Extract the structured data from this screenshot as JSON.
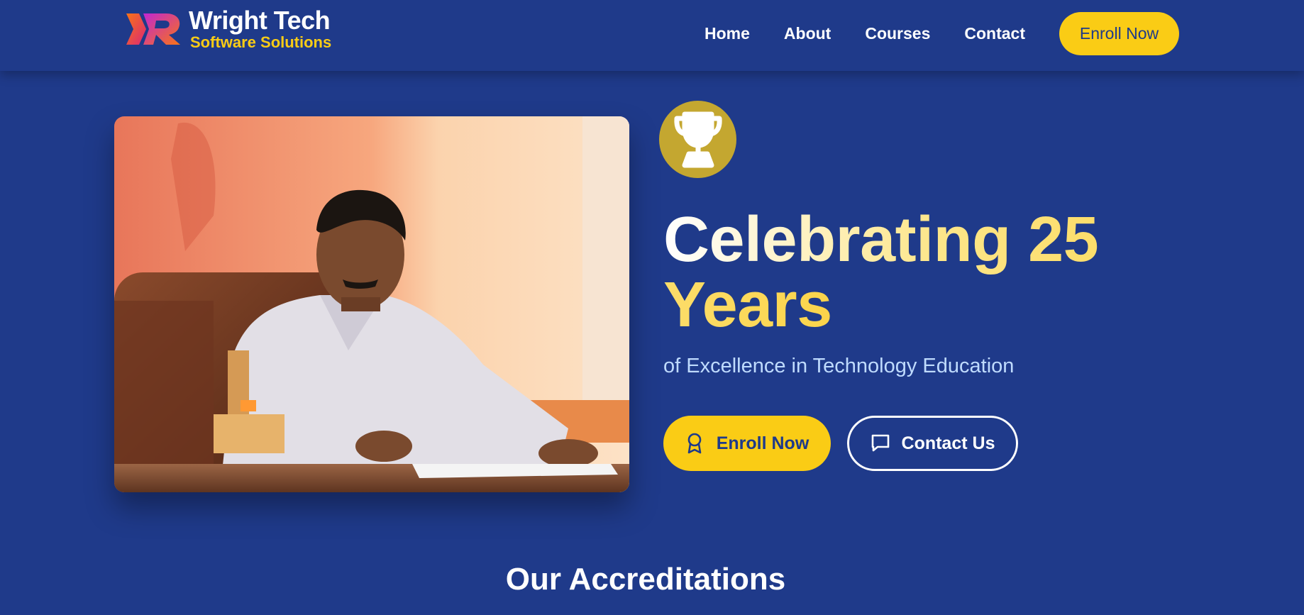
{
  "brand": {
    "name": "Wright Tech",
    "tagline": "Software Solutions",
    "logo_icon": "wr-logo-mark"
  },
  "nav": {
    "items": [
      {
        "label": "Home"
      },
      {
        "label": "About"
      },
      {
        "label": "Courses"
      },
      {
        "label": "Contact"
      }
    ],
    "enroll_label": "Enroll Now"
  },
  "hero": {
    "photo_alt": "Founder seated at office desk",
    "badge_icon": "trophy-icon",
    "headline": "Celebrating 25 Years",
    "subheadline": "of Excellence in Technology Education",
    "primary_button": {
      "label": "Enroll Now",
      "icon": "award-icon"
    },
    "secondary_button": {
      "label": "Contact Us",
      "icon": "message-icon"
    }
  },
  "accreditations": {
    "title": "Our Accreditations"
  },
  "colors": {
    "background": "#1f3a8a",
    "accent": "#facc15",
    "badge": "#c4a730",
    "subtext": "#bfdbfe"
  }
}
